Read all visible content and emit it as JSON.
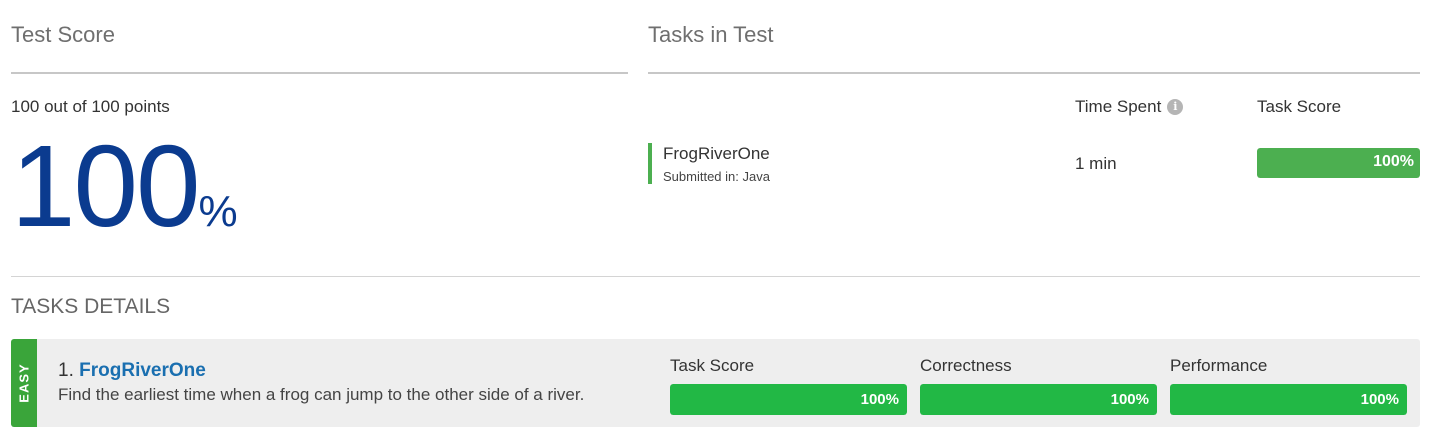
{
  "test_score": {
    "title": "Test Score",
    "points_text": "100 out of 100 points",
    "percent_value": "100",
    "percent_sign": "%"
  },
  "tasks_in_test": {
    "title": "Tasks in Test",
    "columns": {
      "time_spent": "Time Spent",
      "time_spent_info_icon": "info-icon",
      "task_score": "Task Score"
    },
    "tasks": [
      {
        "name": "FrogRiverOne",
        "submitted_in": "Submitted in: Java",
        "time_spent": "1 min",
        "score_label": "100%",
        "score_fraction": 1.0
      }
    ]
  },
  "tasks_details": {
    "title": "TASKS DETAILS",
    "cards": [
      {
        "difficulty": "EASY",
        "number": "1.",
        "name": "FrogRiverOne",
        "description": "Find the earliest time when a frog can jump to the other side of a river.",
        "metrics": [
          {
            "label": "Task Score",
            "value": "100%",
            "fraction": 1.0
          },
          {
            "label": "Correctness",
            "value": "100%",
            "fraction": 1.0
          },
          {
            "label": "Performance",
            "value": "100%",
            "fraction": 1.0
          }
        ]
      }
    ]
  },
  "colors": {
    "percent_blue": "#0b3b8f",
    "score_green": "#4caf50",
    "metric_green": "#22b845",
    "easy_green": "#3aa53a",
    "link_blue": "#1a6fb0"
  }
}
